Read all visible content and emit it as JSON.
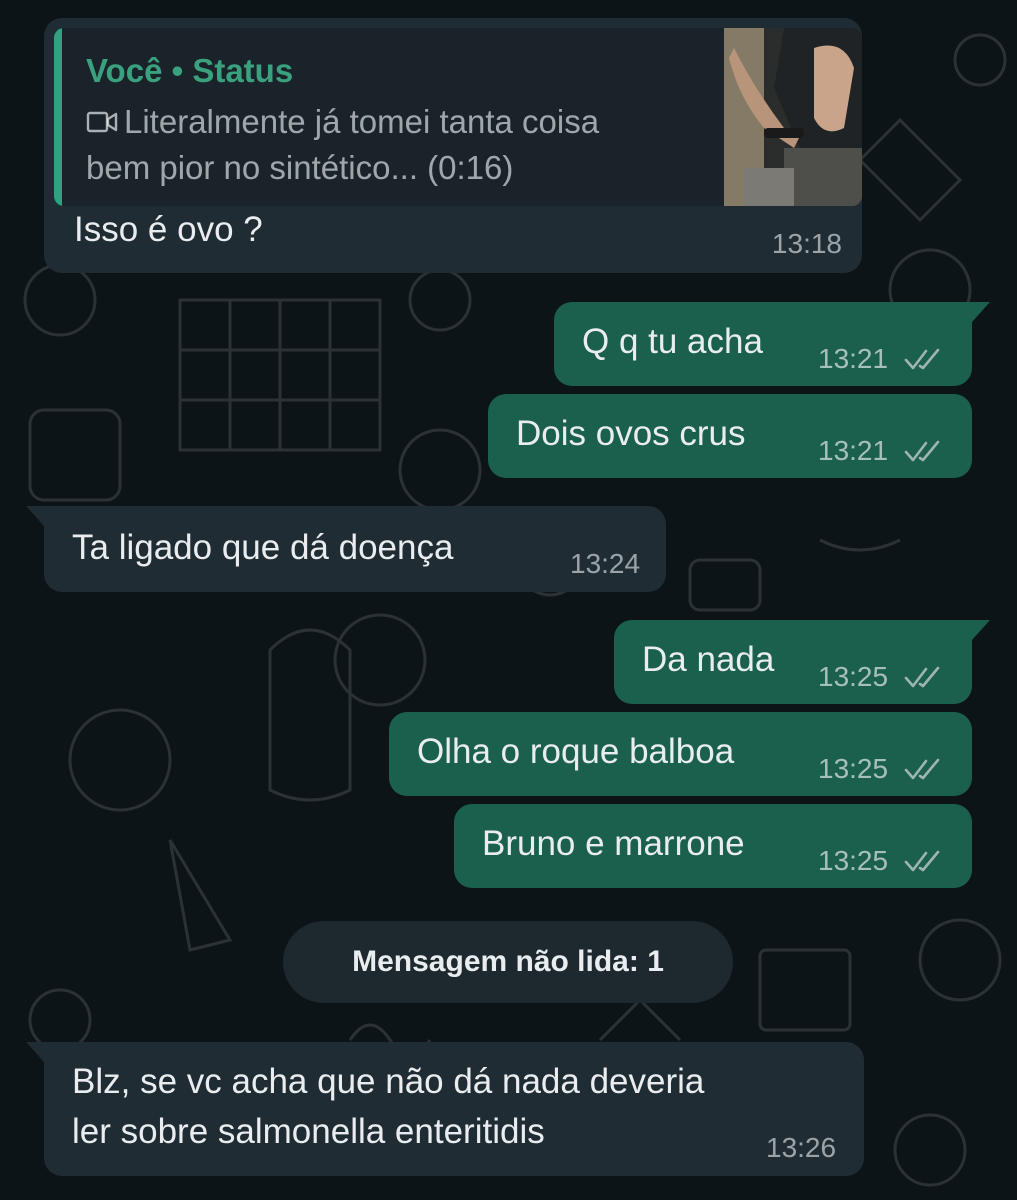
{
  "chat": {
    "quoted_message": {
      "author": "Você • Status",
      "line1": "Literalmente já tomei tanta coisa",
      "line2": "bem pior no sintético... (0:16)",
      "media_icon": "video-camera-icon"
    },
    "messages": [
      {
        "direction": "incoming",
        "text": "Isso é ovo ?",
        "time": "13:18"
      },
      {
        "direction": "outgoing",
        "text": "Q q tu acha",
        "time": "13:21",
        "status": "double-check-icon"
      },
      {
        "direction": "outgoing",
        "text": "Dois ovos crus",
        "time": "13:21",
        "status": "double-check-icon"
      },
      {
        "direction": "incoming",
        "text": "Ta ligado que dá doença",
        "time": "13:24"
      },
      {
        "direction": "outgoing",
        "text": "Da nada",
        "time": "13:25",
        "status": "double-check-icon"
      },
      {
        "direction": "outgoing",
        "text": "Olha o roque balboa",
        "time": "13:25",
        "status": "double-check-icon"
      },
      {
        "direction": "outgoing",
        "text": "Bruno e marrone",
        "time": "13:25",
        "status": "double-check-icon"
      },
      {
        "direction": "incoming",
        "text_line1": "Blz, se vc acha que não dá nada deveria",
        "text_line2": "ler sobre salmonella enteritidis",
        "time": "13:26"
      }
    ],
    "unread_divider": "Mensagem não lida: 1"
  },
  "colors": {
    "background": "#0d1418",
    "incoming_bubble": "#202c33",
    "outgoing_bubble": "#1b5f4d",
    "quote_accent": "#2fa381",
    "read_ticks": "#9fb5b0"
  }
}
